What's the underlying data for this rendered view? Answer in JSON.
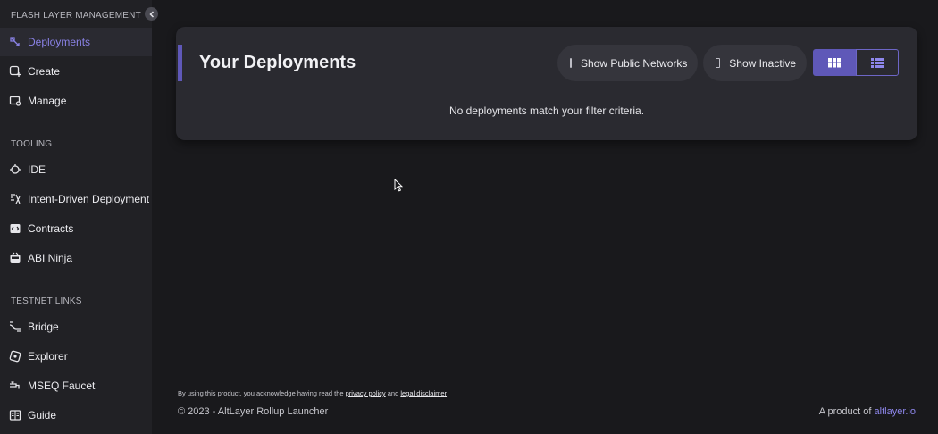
{
  "sidebar": {
    "sections": [
      {
        "title": "FLASH LAYER MANAGEMENT"
      },
      {
        "title": "TOOLING"
      },
      {
        "title": "TESTNET LINKS"
      }
    ],
    "items": [
      {
        "label": "Deployments",
        "icon": "deployments-icon",
        "active": true
      },
      {
        "label": "Create",
        "icon": "create-icon"
      },
      {
        "label": "Manage",
        "icon": "manage-icon"
      },
      {
        "label": "IDE",
        "icon": "ide-icon"
      },
      {
        "label": "Intent-Driven Deployment",
        "icon": "intent-icon"
      },
      {
        "label": "Contracts",
        "icon": "contracts-icon"
      },
      {
        "label": "ABI Ninja",
        "icon": "ninja-icon"
      },
      {
        "label": "Bridge",
        "icon": "bridge-icon"
      },
      {
        "label": "Explorer",
        "icon": "explorer-icon"
      },
      {
        "label": "MSEQ Faucet",
        "icon": "faucet-icon"
      },
      {
        "label": "Guide",
        "icon": "guide-icon"
      }
    ]
  },
  "main": {
    "title": "Your Deployments",
    "filters": {
      "public_networks": "Show Public Networks",
      "inactive": "Show Inactive"
    },
    "empty_message": "No deployments match your filter criteria."
  },
  "footer": {
    "disclaimer_prefix": "By using this product, you acknowledge having read the",
    "privacy_link": "privacy policy",
    "and_text": "and",
    "legal_link": "legal disclaimer",
    "copyright": "© 2023 - AltLayer Rollup Launcher",
    "product_prefix": "A product of",
    "product_link": "altlayer.io"
  },
  "colors": {
    "accent": "#5f58b8",
    "link": "#8e87ec",
    "background": "#19191c",
    "sidebar": "#212125"
  }
}
